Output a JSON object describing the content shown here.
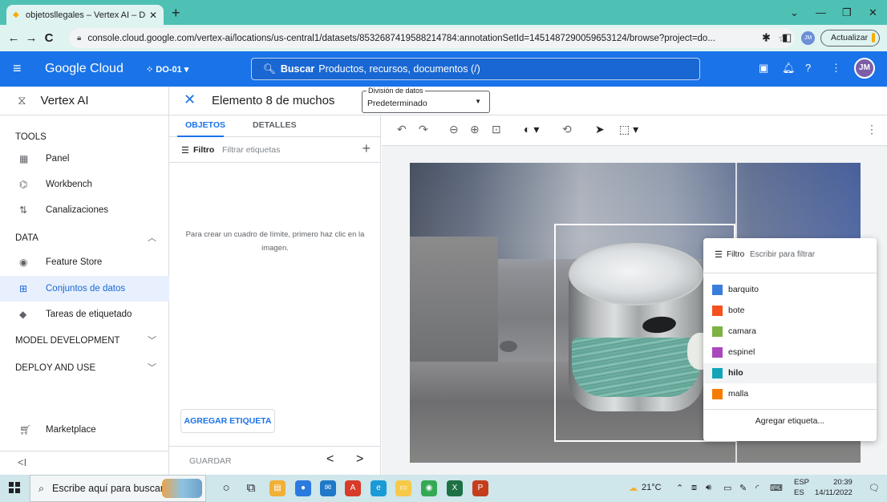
{
  "browser": {
    "tab_title": "objetosllegales – Vertex AI – DO-",
    "tab_close": "✕",
    "new_tab": "+",
    "back": "←",
    "forward": "→",
    "reload": "C",
    "url": "console.cloud.google.com/vertex-ai/locations/us-central1/datasets/8532687419588214784:annotationSetId=1451487290059653124/browse?project=do...",
    "update_button": "Actualizar",
    "profile_initials": "JM"
  },
  "gcp_header": {
    "brand": "Google Cloud",
    "project": "DO-01",
    "search_label": "Buscar",
    "search_placeholder": "Productos, recursos, documentos (/)",
    "avatar_initials": "JM"
  },
  "sidebar": {
    "product": "Vertex AI",
    "sections": [
      {
        "label": "TOOLS"
      },
      {
        "label": "DATA"
      },
      {
        "label": "MODEL DEVELOPMENT"
      },
      {
        "label": "DEPLOY AND USE"
      }
    ],
    "items": [
      {
        "label": "Panel",
        "icon": "dashboard-icon"
      },
      {
        "label": "Workbench",
        "icon": "workbench-icon"
      },
      {
        "label": "Canalizaciones",
        "icon": "pipelines-icon"
      },
      {
        "label": "Feature Store",
        "icon": "feature-store-icon"
      },
      {
        "label": "Conjuntos de datos",
        "icon": "datasets-icon",
        "active": true
      },
      {
        "label": "Tareas de etiquetado",
        "icon": "labeling-icon"
      }
    ],
    "marketplace": "Marketplace",
    "collapse": "<I"
  },
  "panel_header": {
    "title": "Elemento 8 de muchos",
    "split_label": "División de datos",
    "split_value": "Predeterminado"
  },
  "objects_panel": {
    "tabs": [
      "OBJETOS",
      "DETALLES"
    ],
    "active_tab": 0,
    "filter_label": "Filtro",
    "filter_placeholder": "Filtrar etiquetas",
    "hint": "Para crear un cuadro de límite, primero haz clic en la imagen.",
    "add_label_button": "AGREGAR ETIQUETA",
    "save_button": "GUARDAR",
    "prev": "<",
    "next": ">"
  },
  "label_dropdown": {
    "filter_label": "Filtro",
    "filter_placeholder": "Escribir para filtrar",
    "options": [
      {
        "label": "barquito",
        "color": "#3b7ddd"
      },
      {
        "label": "bote",
        "color": "#f4511e"
      },
      {
        "label": "camara",
        "color": "#7cb342"
      },
      {
        "label": "espinel",
        "color": "#ab47bc"
      },
      {
        "label": "hilo",
        "color": "#12a4b8",
        "highlighted": true
      },
      {
        "label": "malla",
        "color": "#f57c00"
      }
    ],
    "add": "Agregar etiqueta..."
  },
  "taskbar": {
    "search_placeholder": "Escribe aquí para buscar",
    "weather": "21°C",
    "lang_top": "ESP",
    "lang_bottom": "ES",
    "time": "20:39",
    "date": "14/11/2022"
  },
  "colors": {
    "brand_blue": "#1a73e8",
    "browser_frame": "#4fc0b4",
    "active_nav_bg": "#e8f0fe"
  }
}
